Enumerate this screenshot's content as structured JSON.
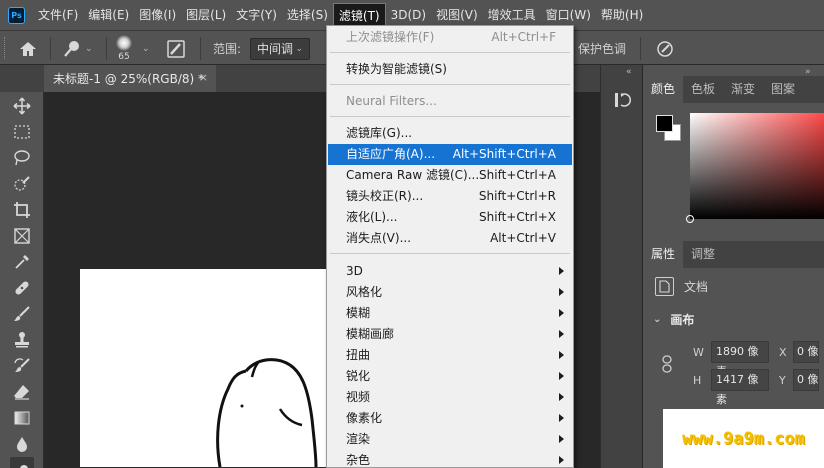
{
  "menubar": {
    "logo": "Ps",
    "items": [
      "文件(F)",
      "编辑(E)",
      "图像(I)",
      "图层(L)",
      "文字(Y)",
      "选择(S)",
      "滤镜(T)",
      "3D(D)",
      "视图(V)",
      "增效工具",
      "窗口(W)",
      "帮助(H)"
    ],
    "active_index": 6
  },
  "options": {
    "brush_size": "65",
    "range_label": "范围:",
    "range_value": "中间调",
    "protect_tones": "保护色调"
  },
  "doc_tab": {
    "title": "未标题-1 @ 25%(RGB/8) *",
    "close": "×"
  },
  "filter_menu": {
    "items": [
      {
        "label": "上次滤镜操作(F)",
        "shortcut": "Alt+Ctrl+F",
        "disabled": true
      },
      {
        "label": "转换为智能滤镜(S)",
        "shortcut": ""
      },
      {
        "label": "Neural Filters...",
        "shortcut": "",
        "disabled": true
      },
      {
        "label": "滤镜库(G)...",
        "shortcut": ""
      },
      {
        "label": "自适应广角(A)...",
        "shortcut": "Alt+Shift+Ctrl+A",
        "highlighted": true
      },
      {
        "label": "Camera Raw 滤镜(C)...",
        "shortcut": "Shift+Ctrl+A"
      },
      {
        "label": "镜头校正(R)...",
        "shortcut": "Shift+Ctrl+R"
      },
      {
        "label": "液化(L)...",
        "shortcut": "Shift+Ctrl+X"
      },
      {
        "label": "消失点(V)...",
        "shortcut": "Alt+Ctrl+V"
      },
      {
        "label": "3D",
        "submenu": true
      },
      {
        "label": "风格化",
        "submenu": true
      },
      {
        "label": "模糊",
        "submenu": true
      },
      {
        "label": "模糊画廊",
        "submenu": true
      },
      {
        "label": "扭曲",
        "submenu": true
      },
      {
        "label": "锐化",
        "submenu": true
      },
      {
        "label": "视频",
        "submenu": true
      },
      {
        "label": "像素化",
        "submenu": true
      },
      {
        "label": "渲染",
        "submenu": true
      },
      {
        "label": "杂色",
        "submenu": true
      }
    ]
  },
  "right_panel": {
    "color_tabs": [
      "颜色",
      "色板",
      "渐变",
      "图案"
    ],
    "props_tabs": [
      "属性",
      "调整"
    ],
    "doc_label": "文档",
    "canvas_section": "画布",
    "width_label": "W",
    "width_value": "1890 像素",
    "height_label": "H",
    "height_value": "1417 像素",
    "x_label": "X",
    "x_value": "0 像素",
    "y_label": "Y",
    "y_value": "0 像素"
  },
  "watermark": "www.9a9m.com",
  "colors": {
    "menu_highlight": "#1673d2",
    "ui_dark": "#535353",
    "watermark": "#f2c200"
  }
}
